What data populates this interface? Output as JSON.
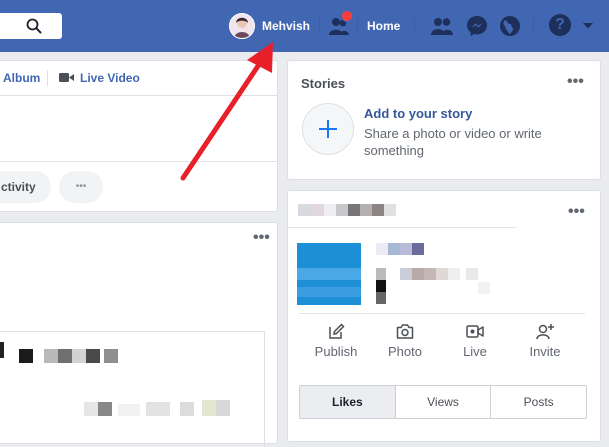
{
  "topbar": {
    "profile_name": "Mehvish",
    "home_label": "Home",
    "help_symbol": "?"
  },
  "composer": {
    "album_label": "Album",
    "live_video_label": "Live Video",
    "activity_label": "ctivity",
    "more_symbol": "•••"
  },
  "stories": {
    "title": "Stories",
    "add_title": "Add to your story",
    "add_subtitle": "Share a photo or video or write something",
    "more_symbol": "•••"
  },
  "page_card": {
    "actions": [
      {
        "label": "Publish",
        "icon": "publish-icon"
      },
      {
        "label": "Photo",
        "icon": "camera-icon"
      },
      {
        "label": "Live",
        "icon": "live-video-icon"
      },
      {
        "label": "Invite",
        "icon": "invite-icon"
      }
    ],
    "tabs": [
      "Likes",
      "Views",
      "Posts"
    ],
    "active_tab": "Likes",
    "more_symbol": "•••"
  },
  "feed": {
    "more_symbol": "•••"
  },
  "colors": {
    "brand": "#4267b2",
    "notification": "#fa3e3e",
    "arrow": "#e8202a",
    "page_logo": "#1c8fd6"
  }
}
